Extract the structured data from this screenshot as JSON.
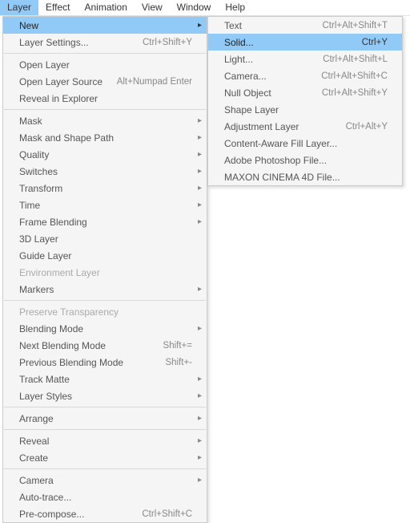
{
  "menubar": {
    "items": [
      {
        "label": "Layer",
        "active": true
      },
      {
        "label": "Effect",
        "active": false
      },
      {
        "label": "Animation",
        "active": false
      },
      {
        "label": "View",
        "active": false
      },
      {
        "label": "Window",
        "active": false
      },
      {
        "label": "Help",
        "active": false
      }
    ]
  },
  "layerMenu": {
    "groups": [
      [
        {
          "label": "New",
          "shortcut": "",
          "submenu": true,
          "highlight": true,
          "disabled": false
        },
        {
          "label": "Layer Settings...",
          "shortcut": "Ctrl+Shift+Y",
          "submenu": false,
          "highlight": false,
          "disabled": false
        }
      ],
      [
        {
          "label": "Open Layer",
          "shortcut": "",
          "submenu": false,
          "highlight": false,
          "disabled": false
        },
        {
          "label": "Open Layer Source",
          "shortcut": "Alt+Numpad Enter",
          "submenu": false,
          "highlight": false,
          "disabled": false
        },
        {
          "label": "Reveal in Explorer",
          "shortcut": "",
          "submenu": false,
          "highlight": false,
          "disabled": false
        }
      ],
      [
        {
          "label": "Mask",
          "shortcut": "",
          "submenu": true,
          "highlight": false,
          "disabled": false
        },
        {
          "label": "Mask and Shape Path",
          "shortcut": "",
          "submenu": true,
          "highlight": false,
          "disabled": false
        },
        {
          "label": "Quality",
          "shortcut": "",
          "submenu": true,
          "highlight": false,
          "disabled": false
        },
        {
          "label": "Switches",
          "shortcut": "",
          "submenu": true,
          "highlight": false,
          "disabled": false
        },
        {
          "label": "Transform",
          "shortcut": "",
          "submenu": true,
          "highlight": false,
          "disabled": false
        },
        {
          "label": "Time",
          "shortcut": "",
          "submenu": true,
          "highlight": false,
          "disabled": false
        },
        {
          "label": "Frame Blending",
          "shortcut": "",
          "submenu": true,
          "highlight": false,
          "disabled": false
        },
        {
          "label": "3D Layer",
          "shortcut": "",
          "submenu": false,
          "highlight": false,
          "disabled": false
        },
        {
          "label": "Guide Layer",
          "shortcut": "",
          "submenu": false,
          "highlight": false,
          "disabled": false
        },
        {
          "label": "Environment Layer",
          "shortcut": "",
          "submenu": false,
          "highlight": false,
          "disabled": true
        },
        {
          "label": "Markers",
          "shortcut": "",
          "submenu": true,
          "highlight": false,
          "disabled": false
        }
      ],
      [
        {
          "label": "Preserve Transparency",
          "shortcut": "",
          "submenu": false,
          "highlight": false,
          "disabled": true
        },
        {
          "label": "Blending Mode",
          "shortcut": "",
          "submenu": true,
          "highlight": false,
          "disabled": false
        },
        {
          "label": "Next Blending Mode",
          "shortcut": "Shift+=",
          "submenu": false,
          "highlight": false,
          "disabled": false
        },
        {
          "label": "Previous Blending Mode",
          "shortcut": "Shift+-",
          "submenu": false,
          "highlight": false,
          "disabled": false
        },
        {
          "label": "Track Matte",
          "shortcut": "",
          "submenu": true,
          "highlight": false,
          "disabled": false
        },
        {
          "label": "Layer Styles",
          "shortcut": "",
          "submenu": true,
          "highlight": false,
          "disabled": false
        }
      ],
      [
        {
          "label": "Arrange",
          "shortcut": "",
          "submenu": true,
          "highlight": false,
          "disabled": false
        }
      ],
      [
        {
          "label": "Reveal",
          "shortcut": "",
          "submenu": true,
          "highlight": false,
          "disabled": false
        },
        {
          "label": "Create",
          "shortcut": "",
          "submenu": true,
          "highlight": false,
          "disabled": false
        }
      ],
      [
        {
          "label": "Camera",
          "shortcut": "",
          "submenu": true,
          "highlight": false,
          "disabled": false
        },
        {
          "label": "Auto-trace...",
          "shortcut": "",
          "submenu": false,
          "highlight": false,
          "disabled": false
        },
        {
          "label": "Pre-compose...",
          "shortcut": "Ctrl+Shift+C",
          "submenu": false,
          "highlight": false,
          "disabled": false
        }
      ]
    ]
  },
  "newSubmenu": {
    "groups": [
      [
        {
          "label": "Text",
          "shortcut": "Ctrl+Alt+Shift+T",
          "highlight": false
        },
        {
          "label": "Solid...",
          "shortcut": "Ctrl+Y",
          "highlight": true
        },
        {
          "label": "Light...",
          "shortcut": "Ctrl+Alt+Shift+L",
          "highlight": false
        },
        {
          "label": "Camera...",
          "shortcut": "Ctrl+Alt+Shift+C",
          "highlight": false
        },
        {
          "label": "Null Object",
          "shortcut": "Ctrl+Alt+Shift+Y",
          "highlight": false
        },
        {
          "label": "Shape Layer",
          "shortcut": "",
          "highlight": false
        },
        {
          "label": "Adjustment Layer",
          "shortcut": "Ctrl+Alt+Y",
          "highlight": false
        },
        {
          "label": "Content-Aware Fill Layer...",
          "shortcut": "",
          "highlight": false
        },
        {
          "label": "Adobe Photoshop File...",
          "shortcut": "",
          "highlight": false
        },
        {
          "label": "MAXON CINEMA 4D File...",
          "shortcut": "",
          "highlight": false
        }
      ]
    ]
  }
}
